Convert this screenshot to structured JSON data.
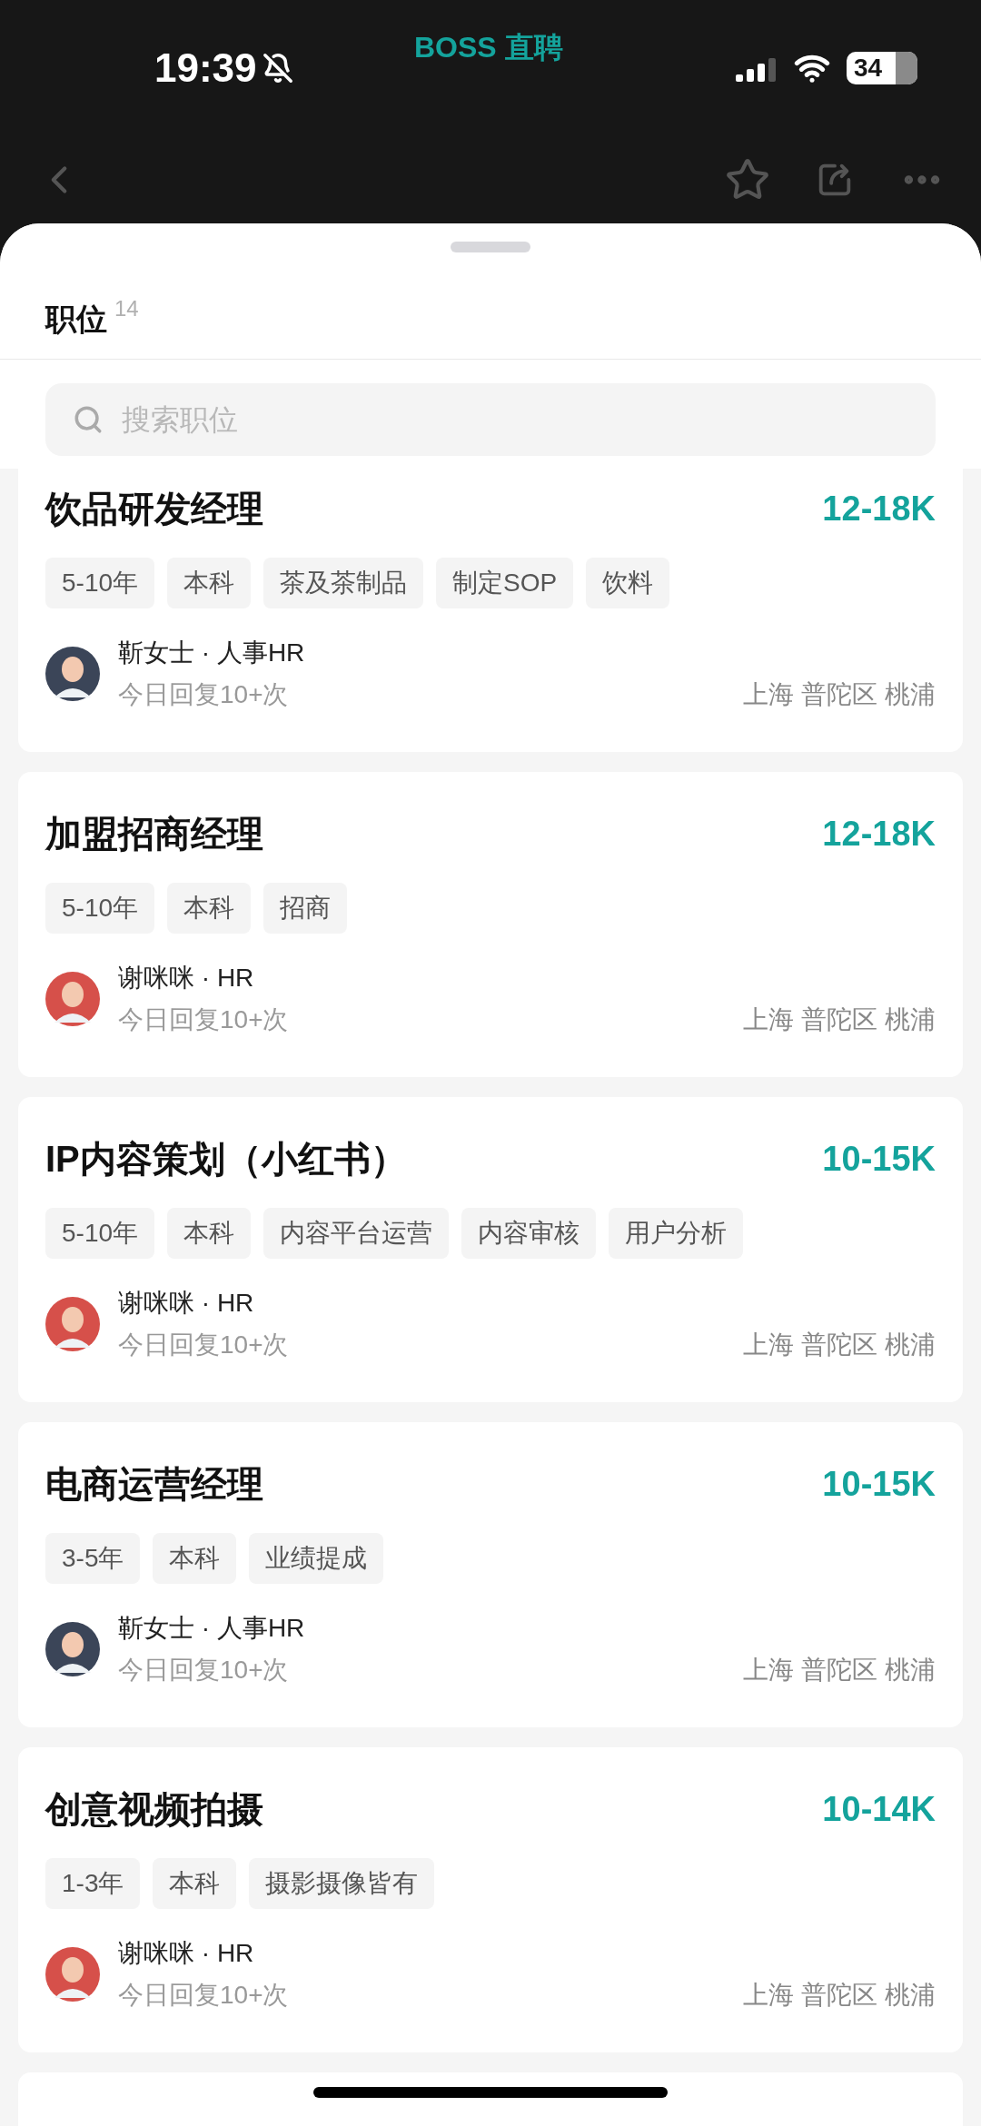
{
  "status_bar": {
    "time": "19:39",
    "app_label": "BOSS 直聘",
    "battery": "34"
  },
  "sheet": {
    "title": "职位",
    "count": "14",
    "search": {
      "placeholder": "搜索职位"
    }
  },
  "jobs": [
    {
      "title": "饮品研发经理",
      "salary": "12-18K",
      "tags": [
        "5-10年",
        "本科",
        "茶及茶制品",
        "制定SOP",
        "饮料"
      ],
      "recruiter": "靳女士 · 人事HR",
      "color": "#3b4558",
      "reply": "今日回复10+次",
      "location": "上海 普陀区 桃浦"
    },
    {
      "title": "加盟招商经理",
      "salary": "12-18K",
      "tags": [
        "5-10年",
        "本科",
        "招商"
      ],
      "recruiter": "谢咪咪 · HR",
      "color": "#d6504a",
      "reply": "今日回复10+次",
      "location": "上海 普陀区 桃浦"
    },
    {
      "title": "IP内容策划（小红书）",
      "salary": "10-15K",
      "tags": [
        "5-10年",
        "本科",
        "内容平台运营",
        "内容审核",
        "用户分析"
      ],
      "recruiter": "谢咪咪 · HR",
      "color": "#d6504a",
      "reply": "今日回复10+次",
      "location": "上海 普陀区 桃浦"
    },
    {
      "title": "电商运营经理",
      "salary": "10-15K",
      "tags": [
        "3-5年",
        "本科",
        "业绩提成"
      ],
      "recruiter": "靳女士 · 人事HR",
      "color": "#3b4558",
      "reply": "今日回复10+次",
      "location": "上海 普陀区 桃浦"
    },
    {
      "title": "创意视频拍摄",
      "salary": "10-14K",
      "tags": [
        "1-3年",
        "本科",
        "摄影摄像皆有"
      ],
      "recruiter": "谢咪咪 · HR",
      "color": "#d6504a",
      "reply": "今日回复10+次",
      "location": "上海 普陀区 桃浦"
    }
  ]
}
